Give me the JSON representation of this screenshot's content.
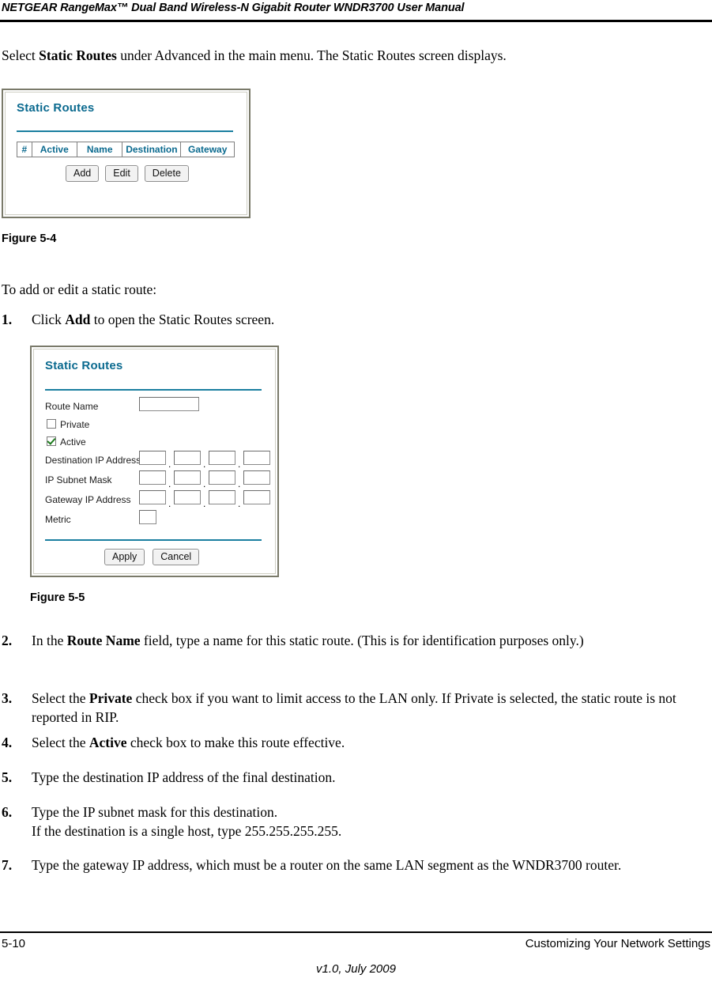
{
  "header": {
    "title": "NETGEAR RangeMax™ Dual Band Wireless-N Gigabit Router WNDR3700 User Manual"
  },
  "intro": {
    "before": "Select ",
    "bold": "Static Routes",
    "after": " under Advanced in the main menu. The Static Routes screen displays."
  },
  "figure1": {
    "caption": "Figure 5-4",
    "screen": {
      "title": "Static Routes",
      "columns": [
        "#",
        "Active",
        "Name",
        "Destination",
        "Gateway"
      ],
      "buttons": [
        "Add",
        "Edit",
        "Delete"
      ]
    }
  },
  "to_add": "To add or edit a static route:",
  "step1": {
    "num": "1.",
    "before": "Click ",
    "bold": "Add",
    "after": " to open the Static Routes screen."
  },
  "figure2": {
    "caption": "Figure 5-5",
    "screen": {
      "title": "Static Routes",
      "fields": {
        "route_name": "Route Name",
        "private": "Private",
        "active": "Active",
        "destination_ip": "Destination IP Address",
        "subnet_mask": "IP Subnet Mask",
        "gateway_ip": "Gateway IP Address",
        "metric": "Metric"
      },
      "values": {
        "route_name": "",
        "private_checked": false,
        "active_checked": true,
        "destination_ip": [
          "",
          "",
          "",
          ""
        ],
        "subnet_mask": [
          "",
          "",
          "",
          ""
        ],
        "gateway_ip": [
          "",
          "",
          "",
          ""
        ],
        "metric": ""
      },
      "separator": ".",
      "buttons": [
        "Apply",
        "Cancel"
      ]
    }
  },
  "steps": [
    {
      "num": "2.",
      "parts": [
        "In the ",
        "Route Name",
        " field, type a name for this static route. (This is for identification purposes only.)"
      ]
    },
    {
      "num": "3.",
      "parts": [
        "Select the ",
        "Private",
        " check box if you want to limit access to the LAN only. If Private is selected, the static route is not reported in RIP."
      ]
    },
    {
      "num": "4.",
      "parts": [
        "Select the ",
        "Active",
        " check box to make this route effective."
      ]
    },
    {
      "num": "5.",
      "parts": [
        "Type the destination IP address of the final destination.",
        "",
        ""
      ]
    },
    {
      "num": "6.",
      "parts": [
        "Type the IP subnet mask for this destination.",
        "",
        ""
      ],
      "line2": "If the destination is a single host, type 255.255.255.255."
    },
    {
      "num": "7.",
      "parts": [
        "Type the gateway IP address, which must be a router on the same LAN segment as the WNDR3700 router.",
        "",
        ""
      ]
    }
  ],
  "footer": {
    "page": "5-10",
    "section": "Customizing Your Network Settings",
    "version": "v1.0, July 2009"
  }
}
